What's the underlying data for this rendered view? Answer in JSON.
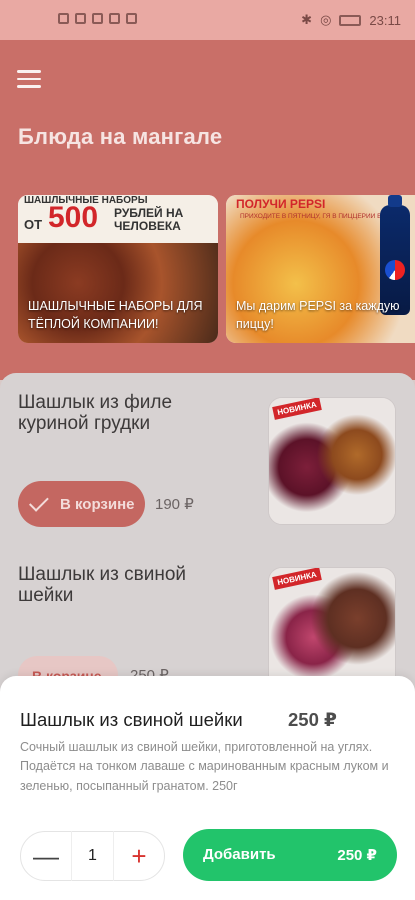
{
  "status_bar": {
    "time": "23:11",
    "colors": {
      "bg": "#e9a9a3"
    }
  },
  "header": {
    "title": "Блюда на мангале"
  },
  "banners": [
    {
      "head_text": "ШАШЛЫЧНЫЕ НАБОРЫ",
      "ot": "ОТ",
      "number": "500",
      "rub_text": "РУБЛЕЙ НА ЧЕЛОВЕКА",
      "caption": "ШАШЛЫЧНЫЕ НАБОРЫ ДЛЯ ТЁПЛОЙ КОМПАНИИ!"
    },
    {
      "head_text": "ПОЛУЧИ PEPSI",
      "sub_text": "ПРИХОДИТЕ В ПЯТНИЦУ, ГЯ В ПИЦЦЕРИИ ВАШЕЙ...",
      "caption": "Мы дарим PEPSI за каждую пиццу!"
    }
  ],
  "items": [
    {
      "name": "Шашлык из филе куриной грудки",
      "cart_label": "В корзине",
      "price": "190 ₽",
      "photo_tag": "НОВИНКА"
    },
    {
      "name": "Шашлык из свиной шейки",
      "cart_label": "В корзине",
      "price": "250 ₽",
      "photo_tag": "НОВИНКА"
    }
  ],
  "sheet": {
    "title": "Шашлык из свиной шейки",
    "price": "250 ₽",
    "description": "Сочный шашлык из свиной шейки, приготовленной на углях. Подаётся на тонком лаваше с маринованным красным луком и зеленью, посыпанный гранатом. 250г",
    "quantity": "1",
    "minus": "—",
    "plus": "+",
    "add_label": "Добавить",
    "add_price": "250 ₽"
  },
  "colors": {
    "accent": "#c96f68",
    "add_button": "#22c46b",
    "plus": "#d8332e"
  }
}
